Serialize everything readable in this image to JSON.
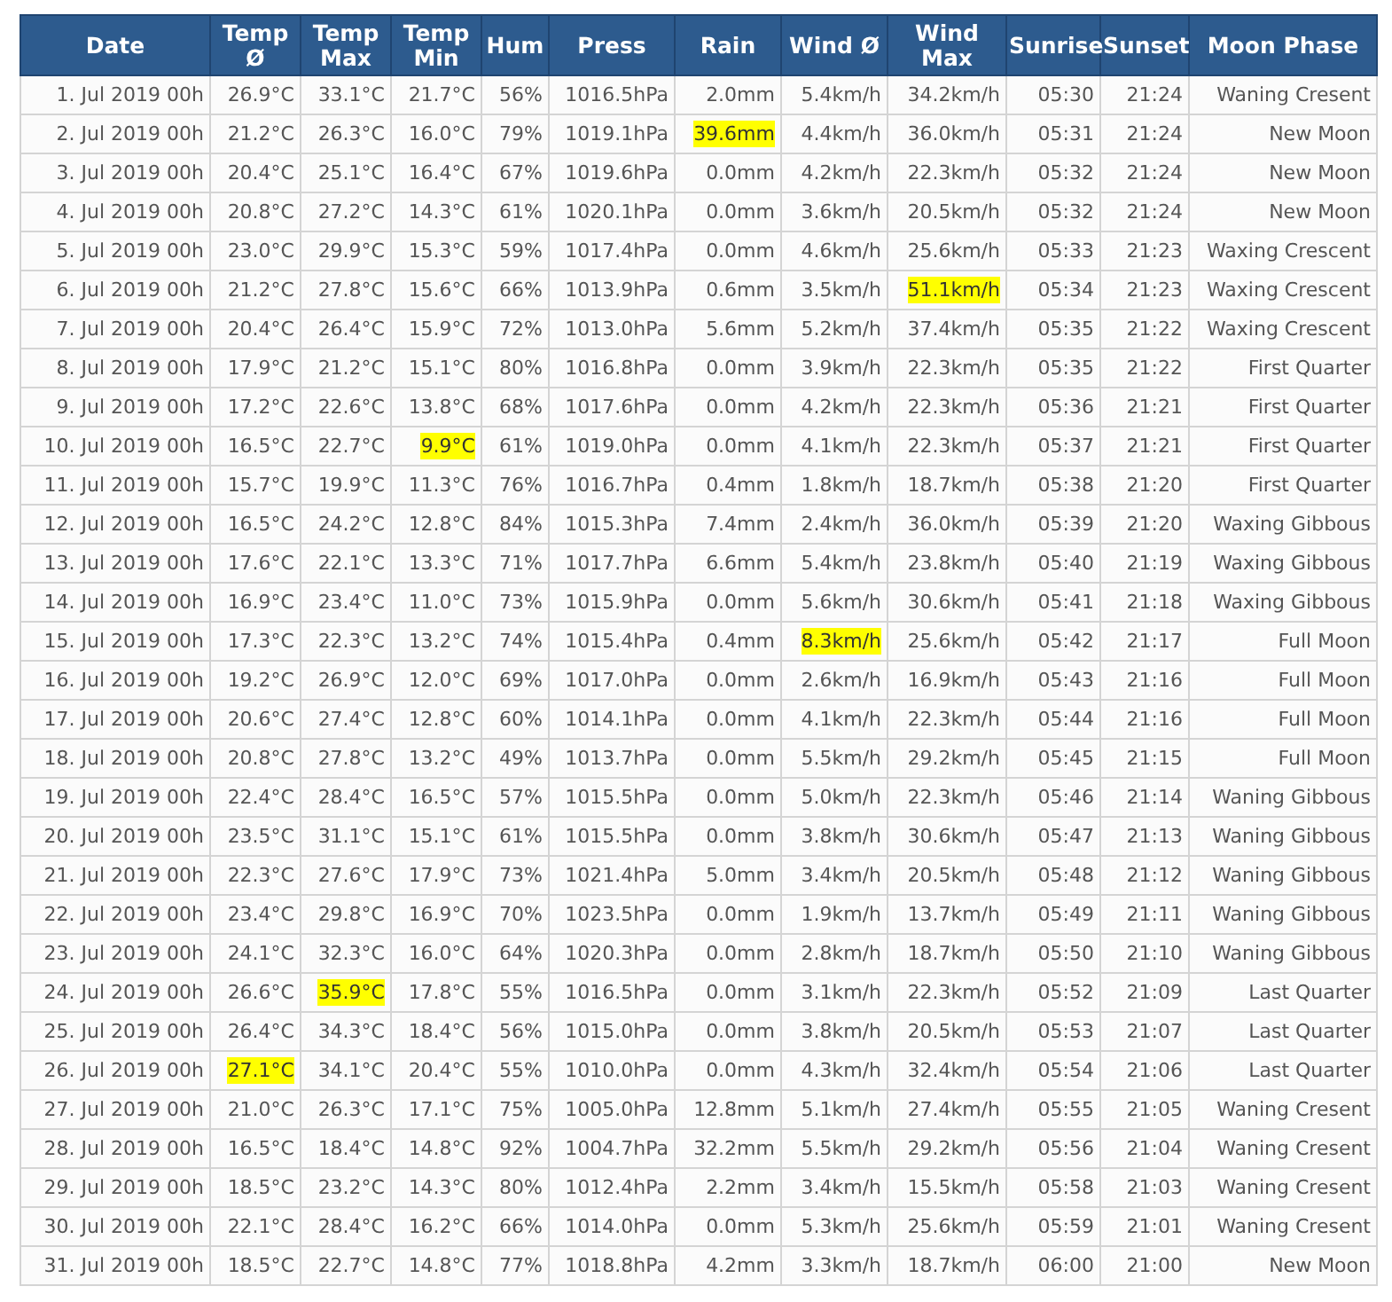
{
  "table": {
    "columns": [
      "Date",
      "Temp Ø",
      "Temp Max",
      "Temp Min",
      "Hum",
      "Press",
      "Rain",
      "Wind Ø",
      "Wind Max",
      "Sunrise",
      "Sunset",
      "Moon Phase"
    ],
    "rows": [
      [
        {
          "text": "1. Jul 2019 00h",
          "highlighted": false
        },
        {
          "text": "26.9°C",
          "highlighted": false
        },
        {
          "text": "33.1°C",
          "highlighted": false
        },
        {
          "text": "21.7°C",
          "highlighted": false
        },
        {
          "text": "56%",
          "highlighted": false
        },
        {
          "text": "1016.5hPa",
          "highlighted": false
        },
        {
          "text": "2.0mm",
          "highlighted": false
        },
        {
          "text": "5.4km/h",
          "highlighted": false
        },
        {
          "text": "34.2km/h",
          "highlighted": false
        },
        {
          "text": "05:30",
          "highlighted": false
        },
        {
          "text": "21:24",
          "highlighted": false
        },
        {
          "text": "Waning Cresent",
          "highlighted": false
        }
      ],
      [
        {
          "text": "2. Jul 2019 00h",
          "highlighted": false
        },
        {
          "text": "21.2°C",
          "highlighted": false
        },
        {
          "text": "26.3°C",
          "highlighted": false
        },
        {
          "text": "16.0°C",
          "highlighted": false
        },
        {
          "text": "79%",
          "highlighted": false
        },
        {
          "text": "1019.1hPa",
          "highlighted": false
        },
        {
          "text": "39.6mm",
          "highlighted": true
        },
        {
          "text": "4.4km/h",
          "highlighted": false
        },
        {
          "text": "36.0km/h",
          "highlighted": false
        },
        {
          "text": "05:31",
          "highlighted": false
        },
        {
          "text": "21:24",
          "highlighted": false
        },
        {
          "text": "New Moon",
          "highlighted": false
        }
      ],
      [
        {
          "text": "3. Jul 2019 00h",
          "highlighted": false
        },
        {
          "text": "20.4°C",
          "highlighted": false
        },
        {
          "text": "25.1°C",
          "highlighted": false
        },
        {
          "text": "16.4°C",
          "highlighted": false
        },
        {
          "text": "67%",
          "highlighted": false
        },
        {
          "text": "1019.6hPa",
          "highlighted": false
        },
        {
          "text": "0.0mm",
          "highlighted": false
        },
        {
          "text": "4.2km/h",
          "highlighted": false
        },
        {
          "text": "22.3km/h",
          "highlighted": false
        },
        {
          "text": "05:32",
          "highlighted": false
        },
        {
          "text": "21:24",
          "highlighted": false
        },
        {
          "text": "New Moon",
          "highlighted": false
        }
      ],
      [
        {
          "text": "4. Jul 2019 00h",
          "highlighted": false
        },
        {
          "text": "20.8°C",
          "highlighted": false
        },
        {
          "text": "27.2°C",
          "highlighted": false
        },
        {
          "text": "14.3°C",
          "highlighted": false
        },
        {
          "text": "61%",
          "highlighted": false
        },
        {
          "text": "1020.1hPa",
          "highlighted": false
        },
        {
          "text": "0.0mm",
          "highlighted": false
        },
        {
          "text": "3.6km/h",
          "highlighted": false
        },
        {
          "text": "20.5km/h",
          "highlighted": false
        },
        {
          "text": "05:32",
          "highlighted": false
        },
        {
          "text": "21:24",
          "highlighted": false
        },
        {
          "text": "New Moon",
          "highlighted": false
        }
      ],
      [
        {
          "text": "5. Jul 2019 00h",
          "highlighted": false
        },
        {
          "text": "23.0°C",
          "highlighted": false
        },
        {
          "text": "29.9°C",
          "highlighted": false
        },
        {
          "text": "15.3°C",
          "highlighted": false
        },
        {
          "text": "59%",
          "highlighted": false
        },
        {
          "text": "1017.4hPa",
          "highlighted": false
        },
        {
          "text": "0.0mm",
          "highlighted": false
        },
        {
          "text": "4.6km/h",
          "highlighted": false
        },
        {
          "text": "25.6km/h",
          "highlighted": false
        },
        {
          "text": "05:33",
          "highlighted": false
        },
        {
          "text": "21:23",
          "highlighted": false
        },
        {
          "text": "Waxing Crescent",
          "highlighted": false
        }
      ],
      [
        {
          "text": "6. Jul 2019 00h",
          "highlighted": false
        },
        {
          "text": "21.2°C",
          "highlighted": false
        },
        {
          "text": "27.8°C",
          "highlighted": false
        },
        {
          "text": "15.6°C",
          "highlighted": false
        },
        {
          "text": "66%",
          "highlighted": false
        },
        {
          "text": "1013.9hPa",
          "highlighted": false
        },
        {
          "text": "0.6mm",
          "highlighted": false
        },
        {
          "text": "3.5km/h",
          "highlighted": false
        },
        {
          "text": "51.1km/h",
          "highlighted": true
        },
        {
          "text": "05:34",
          "highlighted": false
        },
        {
          "text": "21:23",
          "highlighted": false
        },
        {
          "text": "Waxing Crescent",
          "highlighted": false
        }
      ],
      [
        {
          "text": "7. Jul 2019 00h",
          "highlighted": false
        },
        {
          "text": "20.4°C",
          "highlighted": false
        },
        {
          "text": "26.4°C",
          "highlighted": false
        },
        {
          "text": "15.9°C",
          "highlighted": false
        },
        {
          "text": "72%",
          "highlighted": false
        },
        {
          "text": "1013.0hPa",
          "highlighted": false
        },
        {
          "text": "5.6mm",
          "highlighted": false
        },
        {
          "text": "5.2km/h",
          "highlighted": false
        },
        {
          "text": "37.4km/h",
          "highlighted": false
        },
        {
          "text": "05:35",
          "highlighted": false
        },
        {
          "text": "21:22",
          "highlighted": false
        },
        {
          "text": "Waxing Crescent",
          "highlighted": false
        }
      ],
      [
        {
          "text": "8. Jul 2019 00h",
          "highlighted": false
        },
        {
          "text": "17.9°C",
          "highlighted": false
        },
        {
          "text": "21.2°C",
          "highlighted": false
        },
        {
          "text": "15.1°C",
          "highlighted": false
        },
        {
          "text": "80%",
          "highlighted": false
        },
        {
          "text": "1016.8hPa",
          "highlighted": false
        },
        {
          "text": "0.0mm",
          "highlighted": false
        },
        {
          "text": "3.9km/h",
          "highlighted": false
        },
        {
          "text": "22.3km/h",
          "highlighted": false
        },
        {
          "text": "05:35",
          "highlighted": false
        },
        {
          "text": "21:22",
          "highlighted": false
        },
        {
          "text": "First Quarter",
          "highlighted": false
        }
      ],
      [
        {
          "text": "9. Jul 2019 00h",
          "highlighted": false
        },
        {
          "text": "17.2°C",
          "highlighted": false
        },
        {
          "text": "22.6°C",
          "highlighted": false
        },
        {
          "text": "13.8°C",
          "highlighted": false
        },
        {
          "text": "68%",
          "highlighted": false
        },
        {
          "text": "1017.6hPa",
          "highlighted": false
        },
        {
          "text": "0.0mm",
          "highlighted": false
        },
        {
          "text": "4.2km/h",
          "highlighted": false
        },
        {
          "text": "22.3km/h",
          "highlighted": false
        },
        {
          "text": "05:36",
          "highlighted": false
        },
        {
          "text": "21:21",
          "highlighted": false
        },
        {
          "text": "First Quarter",
          "highlighted": false
        }
      ],
      [
        {
          "text": "10. Jul 2019 00h",
          "highlighted": false
        },
        {
          "text": "16.5°C",
          "highlighted": false
        },
        {
          "text": "22.7°C",
          "highlighted": false
        },
        {
          "text": "9.9°C",
          "highlighted": true
        },
        {
          "text": "61%",
          "highlighted": false
        },
        {
          "text": "1019.0hPa",
          "highlighted": false
        },
        {
          "text": "0.0mm",
          "highlighted": false
        },
        {
          "text": "4.1km/h",
          "highlighted": false
        },
        {
          "text": "22.3km/h",
          "highlighted": false
        },
        {
          "text": "05:37",
          "highlighted": false
        },
        {
          "text": "21:21",
          "highlighted": false
        },
        {
          "text": "First Quarter",
          "highlighted": false
        }
      ],
      [
        {
          "text": "11. Jul 2019 00h",
          "highlighted": false
        },
        {
          "text": "15.7°C",
          "highlighted": false
        },
        {
          "text": "19.9°C",
          "highlighted": false
        },
        {
          "text": "11.3°C",
          "highlighted": false
        },
        {
          "text": "76%",
          "highlighted": false
        },
        {
          "text": "1016.7hPa",
          "highlighted": false
        },
        {
          "text": "0.4mm",
          "highlighted": false
        },
        {
          "text": "1.8km/h",
          "highlighted": false
        },
        {
          "text": "18.7km/h",
          "highlighted": false
        },
        {
          "text": "05:38",
          "highlighted": false
        },
        {
          "text": "21:20",
          "highlighted": false
        },
        {
          "text": "First Quarter",
          "highlighted": false
        }
      ],
      [
        {
          "text": "12. Jul 2019 00h",
          "highlighted": false
        },
        {
          "text": "16.5°C",
          "highlighted": false
        },
        {
          "text": "24.2°C",
          "highlighted": false
        },
        {
          "text": "12.8°C",
          "highlighted": false
        },
        {
          "text": "84%",
          "highlighted": false
        },
        {
          "text": "1015.3hPa",
          "highlighted": false
        },
        {
          "text": "7.4mm",
          "highlighted": false
        },
        {
          "text": "2.4km/h",
          "highlighted": false
        },
        {
          "text": "36.0km/h",
          "highlighted": false
        },
        {
          "text": "05:39",
          "highlighted": false
        },
        {
          "text": "21:20",
          "highlighted": false
        },
        {
          "text": "Waxing Gibbous",
          "highlighted": false
        }
      ],
      [
        {
          "text": "13. Jul 2019 00h",
          "highlighted": false
        },
        {
          "text": "17.6°C",
          "highlighted": false
        },
        {
          "text": "22.1°C",
          "highlighted": false
        },
        {
          "text": "13.3°C",
          "highlighted": false
        },
        {
          "text": "71%",
          "highlighted": false
        },
        {
          "text": "1017.7hPa",
          "highlighted": false
        },
        {
          "text": "6.6mm",
          "highlighted": false
        },
        {
          "text": "5.4km/h",
          "highlighted": false
        },
        {
          "text": "23.8km/h",
          "highlighted": false
        },
        {
          "text": "05:40",
          "highlighted": false
        },
        {
          "text": "21:19",
          "highlighted": false
        },
        {
          "text": "Waxing Gibbous",
          "highlighted": false
        }
      ],
      [
        {
          "text": "14. Jul 2019 00h",
          "highlighted": false
        },
        {
          "text": "16.9°C",
          "highlighted": false
        },
        {
          "text": "23.4°C",
          "highlighted": false
        },
        {
          "text": "11.0°C",
          "highlighted": false
        },
        {
          "text": "73%",
          "highlighted": false
        },
        {
          "text": "1015.9hPa",
          "highlighted": false
        },
        {
          "text": "0.0mm",
          "highlighted": false
        },
        {
          "text": "5.6km/h",
          "highlighted": false
        },
        {
          "text": "30.6km/h",
          "highlighted": false
        },
        {
          "text": "05:41",
          "highlighted": false
        },
        {
          "text": "21:18",
          "highlighted": false
        },
        {
          "text": "Waxing Gibbous",
          "highlighted": false
        }
      ],
      [
        {
          "text": "15. Jul 2019 00h",
          "highlighted": false
        },
        {
          "text": "17.3°C",
          "highlighted": false
        },
        {
          "text": "22.3°C",
          "highlighted": false
        },
        {
          "text": "13.2°C",
          "highlighted": false
        },
        {
          "text": "74%",
          "highlighted": false
        },
        {
          "text": "1015.4hPa",
          "highlighted": false
        },
        {
          "text": "0.4mm",
          "highlighted": false
        },
        {
          "text": "8.3km/h",
          "highlighted": true
        },
        {
          "text": "25.6km/h",
          "highlighted": false
        },
        {
          "text": "05:42",
          "highlighted": false
        },
        {
          "text": "21:17",
          "highlighted": false
        },
        {
          "text": "Full Moon",
          "highlighted": false
        }
      ],
      [
        {
          "text": "16. Jul 2019 00h",
          "highlighted": false
        },
        {
          "text": "19.2°C",
          "highlighted": false
        },
        {
          "text": "26.9°C",
          "highlighted": false
        },
        {
          "text": "12.0°C",
          "highlighted": false
        },
        {
          "text": "69%",
          "highlighted": false
        },
        {
          "text": "1017.0hPa",
          "highlighted": false
        },
        {
          "text": "0.0mm",
          "highlighted": false
        },
        {
          "text": "2.6km/h",
          "highlighted": false
        },
        {
          "text": "16.9km/h",
          "highlighted": false
        },
        {
          "text": "05:43",
          "highlighted": false
        },
        {
          "text": "21:16",
          "highlighted": false
        },
        {
          "text": "Full Moon",
          "highlighted": false
        }
      ],
      [
        {
          "text": "17. Jul 2019 00h",
          "highlighted": false
        },
        {
          "text": "20.6°C",
          "highlighted": false
        },
        {
          "text": "27.4°C",
          "highlighted": false
        },
        {
          "text": "12.8°C",
          "highlighted": false
        },
        {
          "text": "60%",
          "highlighted": false
        },
        {
          "text": "1014.1hPa",
          "highlighted": false
        },
        {
          "text": "0.0mm",
          "highlighted": false
        },
        {
          "text": "4.1km/h",
          "highlighted": false
        },
        {
          "text": "22.3km/h",
          "highlighted": false
        },
        {
          "text": "05:44",
          "highlighted": false
        },
        {
          "text": "21:16",
          "highlighted": false
        },
        {
          "text": "Full Moon",
          "highlighted": false
        }
      ],
      [
        {
          "text": "18. Jul 2019 00h",
          "highlighted": false
        },
        {
          "text": "20.8°C",
          "highlighted": false
        },
        {
          "text": "27.8°C",
          "highlighted": false
        },
        {
          "text": "13.2°C",
          "highlighted": false
        },
        {
          "text": "49%",
          "highlighted": false
        },
        {
          "text": "1013.7hPa",
          "highlighted": false
        },
        {
          "text": "0.0mm",
          "highlighted": false
        },
        {
          "text": "5.5km/h",
          "highlighted": false
        },
        {
          "text": "29.2km/h",
          "highlighted": false
        },
        {
          "text": "05:45",
          "highlighted": false
        },
        {
          "text": "21:15",
          "highlighted": false
        },
        {
          "text": "Full Moon",
          "highlighted": false
        }
      ],
      [
        {
          "text": "19. Jul 2019 00h",
          "highlighted": false
        },
        {
          "text": "22.4°C",
          "highlighted": false
        },
        {
          "text": "28.4°C",
          "highlighted": false
        },
        {
          "text": "16.5°C",
          "highlighted": false
        },
        {
          "text": "57%",
          "highlighted": false
        },
        {
          "text": "1015.5hPa",
          "highlighted": false
        },
        {
          "text": "0.0mm",
          "highlighted": false
        },
        {
          "text": "5.0km/h",
          "highlighted": false
        },
        {
          "text": "22.3km/h",
          "highlighted": false
        },
        {
          "text": "05:46",
          "highlighted": false
        },
        {
          "text": "21:14",
          "highlighted": false
        },
        {
          "text": "Waning Gibbous",
          "highlighted": false
        }
      ],
      [
        {
          "text": "20. Jul 2019 00h",
          "highlighted": false
        },
        {
          "text": "23.5°C",
          "highlighted": false
        },
        {
          "text": "31.1°C",
          "highlighted": false
        },
        {
          "text": "15.1°C",
          "highlighted": false
        },
        {
          "text": "61%",
          "highlighted": false
        },
        {
          "text": "1015.5hPa",
          "highlighted": false
        },
        {
          "text": "0.0mm",
          "highlighted": false
        },
        {
          "text": "3.8km/h",
          "highlighted": false
        },
        {
          "text": "30.6km/h",
          "highlighted": false
        },
        {
          "text": "05:47",
          "highlighted": false
        },
        {
          "text": "21:13",
          "highlighted": false
        },
        {
          "text": "Waning Gibbous",
          "highlighted": false
        }
      ],
      [
        {
          "text": "21. Jul 2019 00h",
          "highlighted": false
        },
        {
          "text": "22.3°C",
          "highlighted": false
        },
        {
          "text": "27.6°C",
          "highlighted": false
        },
        {
          "text": "17.9°C",
          "highlighted": false
        },
        {
          "text": "73%",
          "highlighted": false
        },
        {
          "text": "1021.4hPa",
          "highlighted": false
        },
        {
          "text": "5.0mm",
          "highlighted": false
        },
        {
          "text": "3.4km/h",
          "highlighted": false
        },
        {
          "text": "20.5km/h",
          "highlighted": false
        },
        {
          "text": "05:48",
          "highlighted": false
        },
        {
          "text": "21:12",
          "highlighted": false
        },
        {
          "text": "Waning Gibbous",
          "highlighted": false
        }
      ],
      [
        {
          "text": "22. Jul 2019 00h",
          "highlighted": false
        },
        {
          "text": "23.4°C",
          "highlighted": false
        },
        {
          "text": "29.8°C",
          "highlighted": false
        },
        {
          "text": "16.9°C",
          "highlighted": false
        },
        {
          "text": "70%",
          "highlighted": false
        },
        {
          "text": "1023.5hPa",
          "highlighted": false
        },
        {
          "text": "0.0mm",
          "highlighted": false
        },
        {
          "text": "1.9km/h",
          "highlighted": false
        },
        {
          "text": "13.7km/h",
          "highlighted": false
        },
        {
          "text": "05:49",
          "highlighted": false
        },
        {
          "text": "21:11",
          "highlighted": false
        },
        {
          "text": "Waning Gibbous",
          "highlighted": false
        }
      ],
      [
        {
          "text": "23. Jul 2019 00h",
          "highlighted": false
        },
        {
          "text": "24.1°C",
          "highlighted": false
        },
        {
          "text": "32.3°C",
          "highlighted": false
        },
        {
          "text": "16.0°C",
          "highlighted": false
        },
        {
          "text": "64%",
          "highlighted": false
        },
        {
          "text": "1020.3hPa",
          "highlighted": false
        },
        {
          "text": "0.0mm",
          "highlighted": false
        },
        {
          "text": "2.8km/h",
          "highlighted": false
        },
        {
          "text": "18.7km/h",
          "highlighted": false
        },
        {
          "text": "05:50",
          "highlighted": false
        },
        {
          "text": "21:10",
          "highlighted": false
        },
        {
          "text": "Waning Gibbous",
          "highlighted": false
        }
      ],
      [
        {
          "text": "24. Jul 2019 00h",
          "highlighted": false
        },
        {
          "text": "26.6°C",
          "highlighted": false
        },
        {
          "text": "35.9°C",
          "highlighted": true
        },
        {
          "text": "17.8°C",
          "highlighted": false
        },
        {
          "text": "55%",
          "highlighted": false
        },
        {
          "text": "1016.5hPa",
          "highlighted": false
        },
        {
          "text": "0.0mm",
          "highlighted": false
        },
        {
          "text": "3.1km/h",
          "highlighted": false
        },
        {
          "text": "22.3km/h",
          "highlighted": false
        },
        {
          "text": "05:52",
          "highlighted": false
        },
        {
          "text": "21:09",
          "highlighted": false
        },
        {
          "text": "Last Quarter",
          "highlighted": false
        }
      ],
      [
        {
          "text": "25. Jul 2019 00h",
          "highlighted": false
        },
        {
          "text": "26.4°C",
          "highlighted": false
        },
        {
          "text": "34.3°C",
          "highlighted": false
        },
        {
          "text": "18.4°C",
          "highlighted": false
        },
        {
          "text": "56%",
          "highlighted": false
        },
        {
          "text": "1015.0hPa",
          "highlighted": false
        },
        {
          "text": "0.0mm",
          "highlighted": false
        },
        {
          "text": "3.8km/h",
          "highlighted": false
        },
        {
          "text": "20.5km/h",
          "highlighted": false
        },
        {
          "text": "05:53",
          "highlighted": false
        },
        {
          "text": "21:07",
          "highlighted": false
        },
        {
          "text": "Last Quarter",
          "highlighted": false
        }
      ],
      [
        {
          "text": "26. Jul 2019 00h",
          "highlighted": false
        },
        {
          "text": "27.1°C",
          "highlighted": true
        },
        {
          "text": "34.1°C",
          "highlighted": false
        },
        {
          "text": "20.4°C",
          "highlighted": false
        },
        {
          "text": "55%",
          "highlighted": false
        },
        {
          "text": "1010.0hPa",
          "highlighted": false
        },
        {
          "text": "0.0mm",
          "highlighted": false
        },
        {
          "text": "4.3km/h",
          "highlighted": false
        },
        {
          "text": "32.4km/h",
          "highlighted": false
        },
        {
          "text": "05:54",
          "highlighted": false
        },
        {
          "text": "21:06",
          "highlighted": false
        },
        {
          "text": "Last Quarter",
          "highlighted": false
        }
      ],
      [
        {
          "text": "27. Jul 2019 00h",
          "highlighted": false
        },
        {
          "text": "21.0°C",
          "highlighted": false
        },
        {
          "text": "26.3°C",
          "highlighted": false
        },
        {
          "text": "17.1°C",
          "highlighted": false
        },
        {
          "text": "75%",
          "highlighted": false
        },
        {
          "text": "1005.0hPa",
          "highlighted": false
        },
        {
          "text": "12.8mm",
          "highlighted": false
        },
        {
          "text": "5.1km/h",
          "highlighted": false
        },
        {
          "text": "27.4km/h",
          "highlighted": false
        },
        {
          "text": "05:55",
          "highlighted": false
        },
        {
          "text": "21:05",
          "highlighted": false
        },
        {
          "text": "Waning Cresent",
          "highlighted": false
        }
      ],
      [
        {
          "text": "28. Jul 2019 00h",
          "highlighted": false
        },
        {
          "text": "16.5°C",
          "highlighted": false
        },
        {
          "text": "18.4°C",
          "highlighted": false
        },
        {
          "text": "14.8°C",
          "highlighted": false
        },
        {
          "text": "92%",
          "highlighted": false
        },
        {
          "text": "1004.7hPa",
          "highlighted": false
        },
        {
          "text": "32.2mm",
          "highlighted": false
        },
        {
          "text": "5.5km/h",
          "highlighted": false
        },
        {
          "text": "29.2km/h",
          "highlighted": false
        },
        {
          "text": "05:56",
          "highlighted": false
        },
        {
          "text": "21:04",
          "highlighted": false
        },
        {
          "text": "Waning Cresent",
          "highlighted": false
        }
      ],
      [
        {
          "text": "29. Jul 2019 00h",
          "highlighted": false
        },
        {
          "text": "18.5°C",
          "highlighted": false
        },
        {
          "text": "23.2°C",
          "highlighted": false
        },
        {
          "text": "14.3°C",
          "highlighted": false
        },
        {
          "text": "80%",
          "highlighted": false
        },
        {
          "text": "1012.4hPa",
          "highlighted": false
        },
        {
          "text": "2.2mm",
          "highlighted": false
        },
        {
          "text": "3.4km/h",
          "highlighted": false
        },
        {
          "text": "15.5km/h",
          "highlighted": false
        },
        {
          "text": "05:58",
          "highlighted": false
        },
        {
          "text": "21:03",
          "highlighted": false
        },
        {
          "text": "Waning Cresent",
          "highlighted": false
        }
      ],
      [
        {
          "text": "30. Jul 2019 00h",
          "highlighted": false
        },
        {
          "text": "22.1°C",
          "highlighted": false
        },
        {
          "text": "28.4°C",
          "highlighted": false
        },
        {
          "text": "16.2°C",
          "highlighted": false
        },
        {
          "text": "66%",
          "highlighted": false
        },
        {
          "text": "1014.0hPa",
          "highlighted": false
        },
        {
          "text": "0.0mm",
          "highlighted": false
        },
        {
          "text": "5.3km/h",
          "highlighted": false
        },
        {
          "text": "25.6km/h",
          "highlighted": false
        },
        {
          "text": "05:59",
          "highlighted": false
        },
        {
          "text": "21:01",
          "highlighted": false
        },
        {
          "text": "Waning Cresent",
          "highlighted": false
        }
      ],
      [
        {
          "text": "31. Jul 2019 00h",
          "highlighted": false
        },
        {
          "text": "18.5°C",
          "highlighted": false
        },
        {
          "text": "22.7°C",
          "highlighted": false
        },
        {
          "text": "14.8°C",
          "highlighted": false
        },
        {
          "text": "77%",
          "highlighted": false
        },
        {
          "text": "1018.8hPa",
          "highlighted": false
        },
        {
          "text": "4.2mm",
          "highlighted": false
        },
        {
          "text": "3.3km/h",
          "highlighted": false
        },
        {
          "text": "18.7km/h",
          "highlighted": false
        },
        {
          "text": "06:00",
          "highlighted": false
        },
        {
          "text": "21:00",
          "highlighted": false
        },
        {
          "text": "New Moon",
          "highlighted": false
        }
      ]
    ]
  }
}
